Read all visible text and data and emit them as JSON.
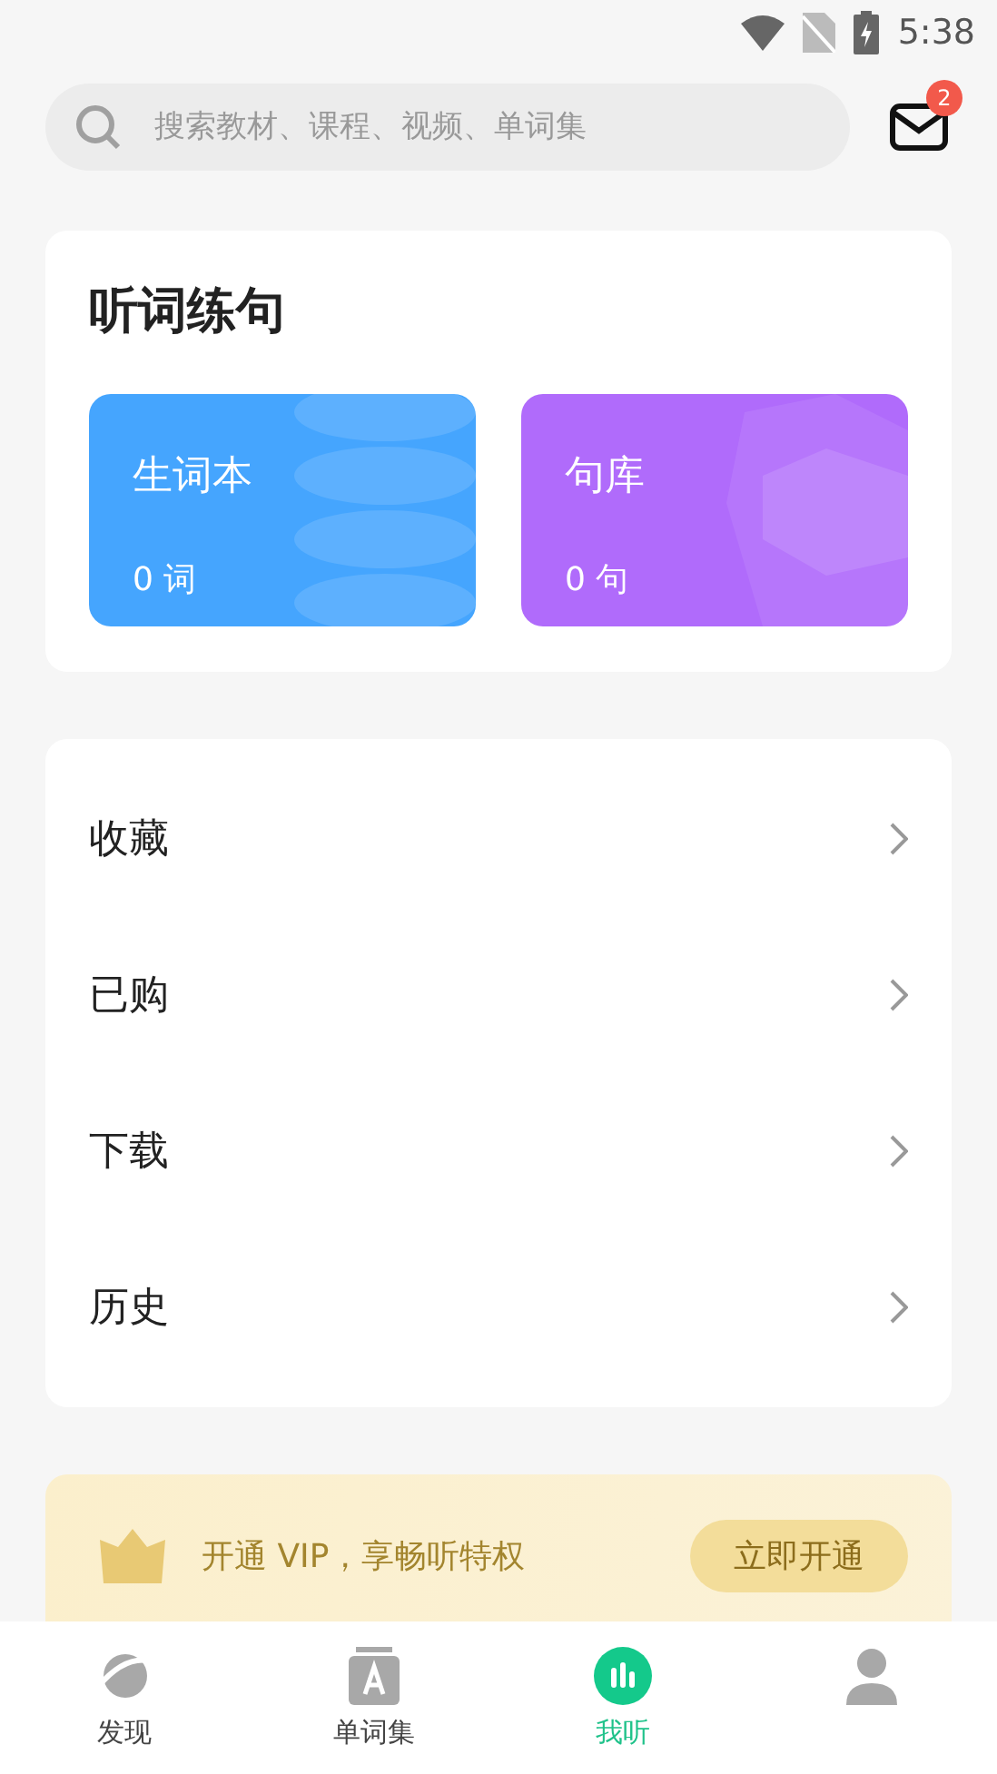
{
  "status_bar": {
    "time": "5:38"
  },
  "search": {
    "placeholder": "搜索教材、课程、视频、单词集"
  },
  "messages": {
    "badge": "2"
  },
  "practice": {
    "title": "听词练句",
    "tiles": [
      {
        "kind": "circles",
        "title": "生词本",
        "count": "0 词",
        "color": "#45a5fe"
      },
      {
        "kind": "hexagons",
        "title": "句库",
        "count": "0 句",
        "color": "#b06bfb"
      }
    ]
  },
  "menu": [
    {
      "label": "收藏"
    },
    {
      "label": "已购"
    },
    {
      "label": "下载"
    },
    {
      "label": "历史"
    }
  ],
  "vip": {
    "text": "开通 VIP，享畅听特权",
    "button": "立即开通"
  },
  "tabs": [
    {
      "kind": "planet",
      "label": "发现",
      "selected": false
    },
    {
      "kind": "book",
      "label": "单词集",
      "selected": false
    },
    {
      "kind": "bars",
      "label": "我听",
      "selected": true
    },
    {
      "kind": "person",
      "selected": false
    }
  ]
}
